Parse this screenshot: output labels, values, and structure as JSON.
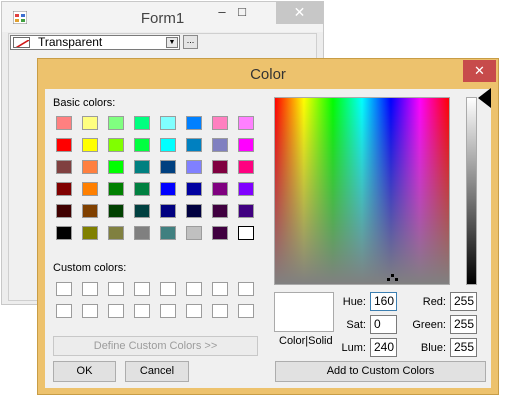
{
  "form1": {
    "title": "Form1",
    "minimize_glyph": "–",
    "maximize_glyph": "□",
    "close_glyph": "✕",
    "combo": {
      "value": "Transparent"
    },
    "ellipsis_label": "..."
  },
  "dialog": {
    "title": "Color",
    "close_glyph": "✕",
    "basic_colors_label": "Basic colors:",
    "custom_colors_label": "Custom colors:",
    "define_custom_label": "Define Custom Colors >>",
    "ok_label": "OK",
    "cancel_label": "Cancel",
    "add_custom_label": "Add to Custom Colors",
    "color_solid_label": "Color|Solid",
    "fields": {
      "hue_label": "Hue:",
      "hue": "160",
      "sat_label": "Sat:",
      "sat": "0",
      "lum_label": "Lum:",
      "lum": "240",
      "red_label": "Red:",
      "red": "255",
      "green_label": "Green:",
      "green": "255",
      "blue_label": "Blue:",
      "blue": "255"
    },
    "basic_colors": [
      [
        "#ff8080",
        "#ffff80",
        "#80ff80",
        "#00ff80",
        "#80ffff",
        "#0080ff",
        "#ff80c0",
        "#ff80ff"
      ],
      [
        "#ff0000",
        "#ffff00",
        "#80ff00",
        "#00ff40",
        "#00ffff",
        "#0080c0",
        "#8080c0",
        "#ff00ff"
      ],
      [
        "#804040",
        "#ff8040",
        "#00ff00",
        "#008080",
        "#004080",
        "#8080ff",
        "#800040",
        "#ff0080"
      ],
      [
        "#800000",
        "#ff8000",
        "#008000",
        "#008040",
        "#0000ff",
        "#0000a0",
        "#800080",
        "#8000ff"
      ],
      [
        "#400000",
        "#804000",
        "#004000",
        "#004040",
        "#000080",
        "#000040",
        "#400040",
        "#400080"
      ],
      [
        "#000000",
        "#808000",
        "#808040",
        "#808080",
        "#408080",
        "#c0c0c0",
        "#400040",
        "#ffffff"
      ]
    ],
    "selected_basic": "5.7"
  }
}
